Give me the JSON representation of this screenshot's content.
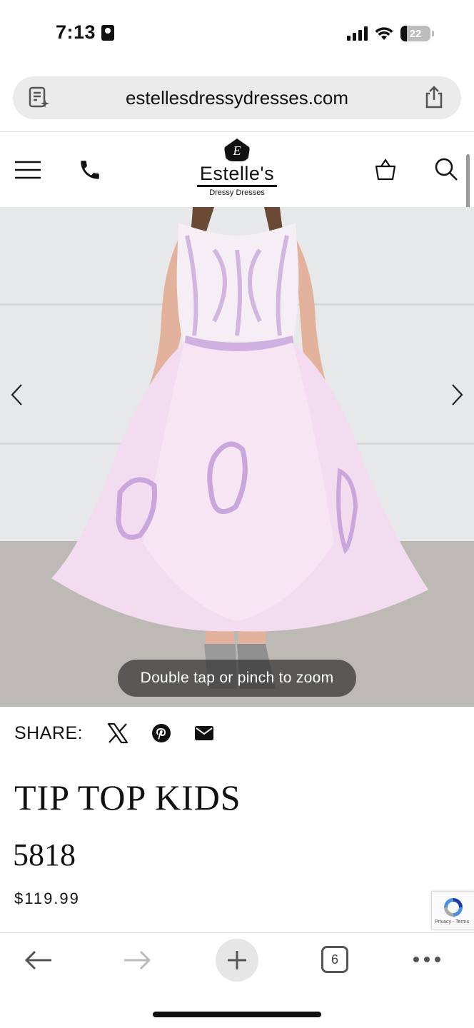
{
  "status_bar": {
    "time": "7:13",
    "battery": "22",
    "person_icon": "contact-card-icon"
  },
  "browser": {
    "url": "estellesdressydresses.com",
    "left_icon": "page-summary-icon",
    "right_icon": "share-icon",
    "tab_count": "6"
  },
  "site_header": {
    "logo_mark": "E",
    "logo_name": "Estelle's",
    "logo_sub": "Dressy Dresses"
  },
  "hero": {
    "zoom_hint": "Double tap or pinch to zoom",
    "dress_colors": {
      "tulle": "#f3dcf0",
      "bodice": "#f6eef5",
      "lace": "#c9a6dc"
    }
  },
  "share": {
    "label": "SHARE:",
    "icons": [
      "x-twitter-icon",
      "pinterest-icon",
      "email-icon"
    ]
  },
  "product": {
    "brand": "TIP TOP KIDS",
    "style_number": "5818",
    "price": "$119.99"
  },
  "recaptcha": {
    "text": "Privacy - Terms"
  }
}
